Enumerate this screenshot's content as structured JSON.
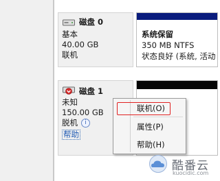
{
  "disks": [
    {
      "name": "磁盘 0",
      "type": "基本",
      "size": "40.00 GB",
      "status": "联机",
      "partition": {
        "title": "系统保留",
        "detail": "350 MB NTFS",
        "status": "状态良好 (系统, 活动"
      }
    },
    {
      "name": "磁盘 1",
      "type": "未知",
      "size": "150.00 GB",
      "status": "脱机",
      "help_label": "帮助"
    }
  ],
  "context_menu": {
    "items": [
      "联机(O)",
      "属性(P)",
      "帮助(H)"
    ],
    "highlighted_index": 0
  },
  "watermark": {
    "brand": "酷番云",
    "site": "kuocidic.com"
  },
  "colors": {
    "partition_bar": "#0a1c7d",
    "unallocated_bar": "#050505",
    "highlight_border": "#e02020",
    "link": "#1f5ab3"
  }
}
